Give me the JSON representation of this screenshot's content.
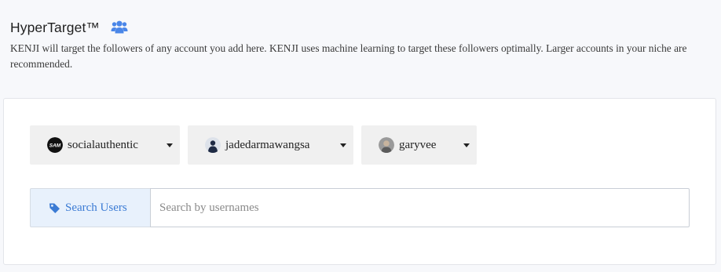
{
  "header": {
    "title": "HyperTarget™",
    "description": "KENJI will target the followers of any account you add here. KENJI uses machine learning to target these followers optimally. Larger accounts in your niche are recommended."
  },
  "accounts": [
    {
      "username": "socialauthentic",
      "avatar_icon": "sam-logo-avatar"
    },
    {
      "username": "jadedarmawangsa",
      "avatar_icon": "person-photo-avatar"
    },
    {
      "username": "garyvee",
      "avatar_icon": "person-photo-avatar"
    }
  ],
  "search": {
    "button_label": "Search Users",
    "placeholder": "Search by usernames",
    "value": ""
  },
  "colors": {
    "accent_blue": "#3b7bd4",
    "icon_blue": "#4a86e8",
    "page_bg": "#f7f8fb",
    "dropdown_bg": "#f0f0f0",
    "search_button_bg": "#e8f1fc"
  }
}
